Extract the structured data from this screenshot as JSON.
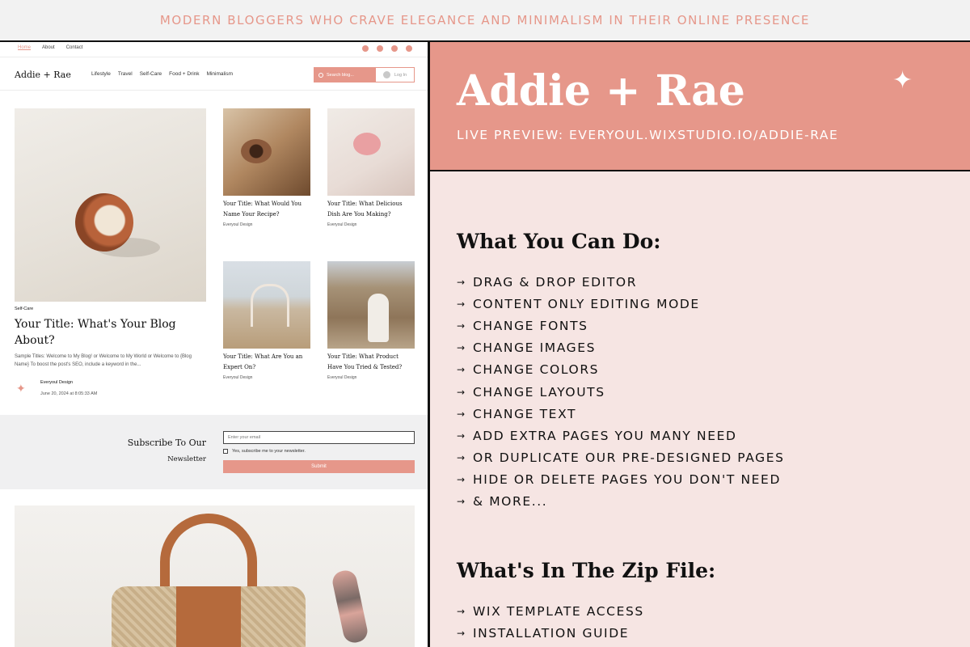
{
  "banner": {
    "text": "MODERN BLOGGERS WHO CRAVE ELEGANCE AND MINIMALISM IN THEIR ONLINE PRESENCE"
  },
  "site": {
    "top_links": [
      "Home",
      "About",
      "Contact"
    ],
    "social_icons": [
      "facebook-icon",
      "pinterest-icon",
      "instagram-icon",
      "youtube-icon"
    ],
    "logo": "Addie + Rae",
    "nav": [
      "Lifestyle",
      "Travel",
      "Self-Care",
      "Food + Drink",
      "Minimalism"
    ],
    "search_placeholder": "Search blog...",
    "login": "Log In",
    "featured": {
      "category": "Self-Care",
      "title": "Your Title: What's Your Blog About?",
      "excerpt": "Sample Titles: Welcome to My Blog! or Welcome to My World or Welcome to {Blog Name} To boost the post's SEO, include a keyword in the...",
      "author": "Everyoul Design",
      "date": "June 20, 2024 at 8:05:33 AM"
    },
    "cards": [
      {
        "title": "Your Title: What Would You Name Your Recipe?",
        "author": "Everyoul Design"
      },
      {
        "title": "Your Title: What Delicious Dish Are You Making?",
        "author": "Everyoul Design"
      },
      {
        "title": "Your Title: What Are You an Expert On?",
        "author": "Everyoul Design"
      },
      {
        "title": "Your Title: What Product Have You Tried & Tested?",
        "author": "Everyoul Design"
      }
    ],
    "newsletter": {
      "title": "Subscribe To Our",
      "subtitle": "Newsletter",
      "email_placeholder": "Enter your email",
      "checkbox_label": "Yes, subscribe me to your newsletter.",
      "submit": "Submit"
    }
  },
  "panel": {
    "brand": "Addie + Rae",
    "sparkle": "✦",
    "preview": "LIVE PREVIEW: EVERYOUL.WIXSTUDIO.IO/ADDIE-RAE",
    "section1_title": "What You Can Do:",
    "section1_items": [
      "DRAG & DROP EDITOR",
      "CONTENT ONLY EDITING MODE",
      "CHANGE FONTS",
      "CHANGE IMAGES",
      "CHANGE COLORS",
      "CHANGE LAYOUTS",
      "CHANGE TEXT",
      "ADD EXTRA PAGES YOU MANY NEED",
      "OR DUPLICATE OUR PRE-DESIGNED PAGES",
      "HIDE OR DELETE PAGES YOU DON'T NEED",
      "& MORE..."
    ],
    "section2_title": "What's In The Zip File:",
    "section2_items": [
      "WIX TEMPLATE ACCESS",
      "INSTALLATION GUIDE"
    ],
    "arrow": "→"
  },
  "colors": {
    "accent": "#e6978a",
    "panel_bg": "#f6e5e3",
    "dark": "#111111"
  }
}
